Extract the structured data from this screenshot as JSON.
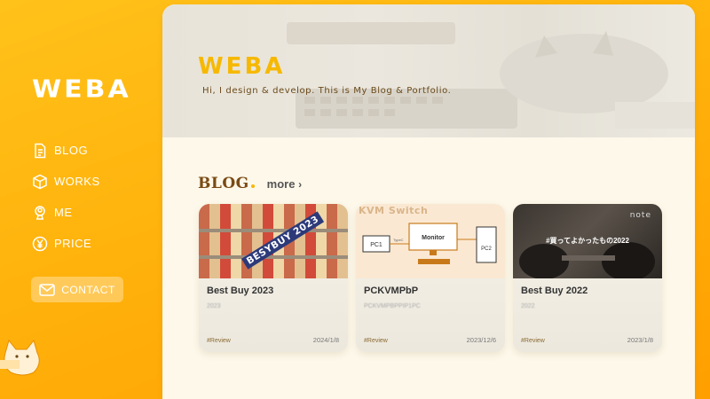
{
  "brand": {
    "logo": "WEBA"
  },
  "sidebar": {
    "items": [
      {
        "label": "BLOG",
        "icon": "document-icon"
      },
      {
        "label": "WORKS",
        "icon": "box-icon"
      },
      {
        "label": "ME",
        "icon": "user-badge-icon"
      },
      {
        "label": "PRICE",
        "icon": "yen-icon"
      }
    ],
    "contact": {
      "label": "CONTACT",
      "icon": "mail-icon"
    }
  },
  "hero": {
    "logo": "WEBA",
    "tagline": "Hi, I design & develop. This is My Blog & Portfolio."
  },
  "blog_section": {
    "title": "BLOG",
    "more_label": "more",
    "more_icon": "chevron-right-icon"
  },
  "cards": [
    {
      "thumb_text": "BESYBUY 2023",
      "title": "Best Buy 2023",
      "desc": "2023",
      "tag": "#Review",
      "date": "2024/1/8"
    },
    {
      "thumb_text": "KVM Switch",
      "thumb_labels": {
        "pc1": "PC1",
        "pc2": "PC2",
        "monitor": "Monitor",
        "typec": "TypeC"
      },
      "title": "PCKVMPbP",
      "desc": "PCKVMPBPPIP1PC",
      "tag": "#Review",
      "date": "2023/12/6"
    },
    {
      "thumb_text": "#買ってよかったもの2022",
      "thumb_brand": "note",
      "title": "Best Buy 2022",
      "desc": "2022",
      "tag": "#Review",
      "date": "2023/1/8"
    }
  ],
  "colors": {
    "accent": "#f6b800",
    "background": "#ffb20c",
    "panel": "#fdf8ea",
    "heading": "#7a4a14"
  }
}
